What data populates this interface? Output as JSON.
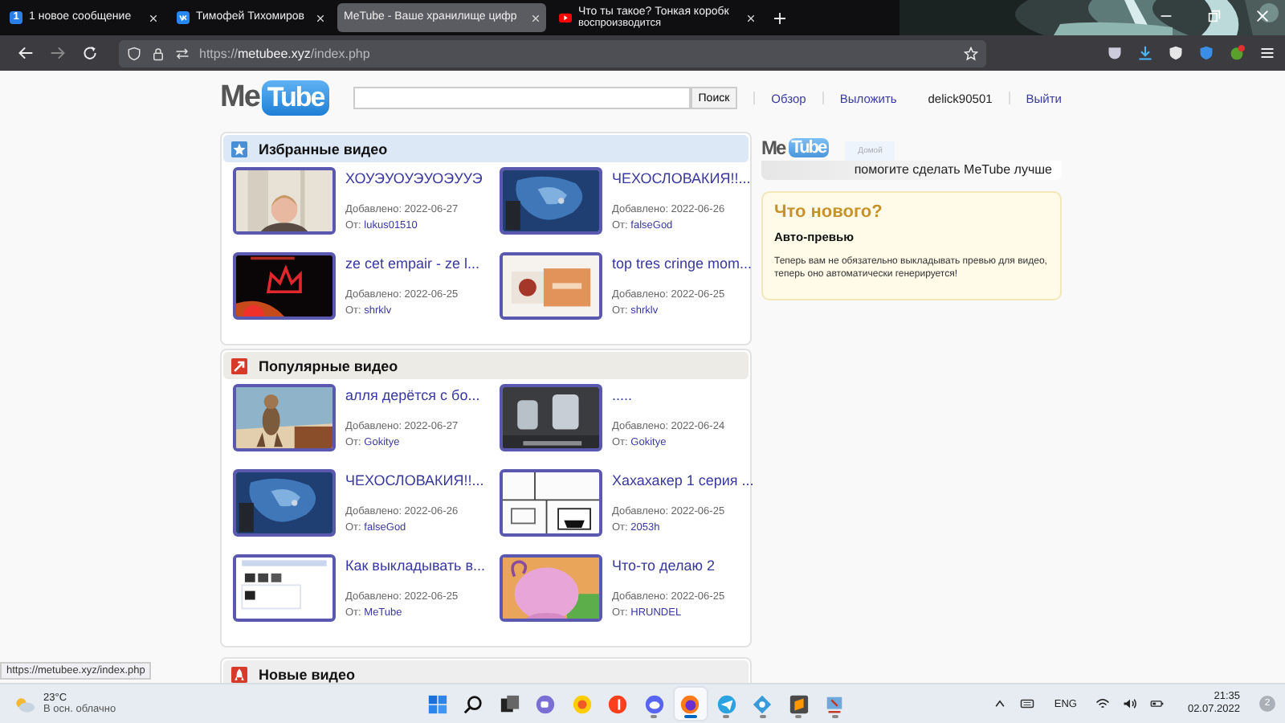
{
  "browser": {
    "tabs": [
      {
        "kind": "mail",
        "icon_text": "1",
        "title": "1 новое сообщение",
        "selected": false
      },
      {
        "kind": "social",
        "title": "Тимофей Тихомиров",
        "selected": false
      },
      {
        "kind": "page",
        "title": "MeTube - Ваше хранилище цифр",
        "selected": true
      },
      {
        "kind": "video",
        "title": "Что ты такое? Тонкая коробк",
        "subtitle": "воспроизводится",
        "selected": false
      }
    ],
    "url": {
      "scheme": "https://",
      "host": "metubee.xyz",
      "path": "/index.php"
    },
    "status_url": "https://metubee.xyz/index.php"
  },
  "site": {
    "logo": {
      "left": "Me",
      "right": "Tube"
    },
    "search_button": "Поиск",
    "nav_links": [
      "Обзор",
      "Выложить"
    ],
    "user": "delick90501",
    "logout": "Выйти",
    "sections": [
      {
        "kind": "favorites",
        "title": "Избранные видео",
        "videos": [
          {
            "title": "ХОУЭУОУЭУОЭУУЭ",
            "added": "Добавлено: 2022-06-27",
            "by": "От:",
            "author": "lukus01510"
          },
          {
            "title": "ЧЕХОСЛОВАКИЯ!!...",
            "added": "Добавлено: 2022-06-26",
            "by": "От:",
            "author": "falseGod"
          },
          {
            "title": "ze cet empair - ze l...",
            "added": "Добавлено: 2022-06-25",
            "by": "От:",
            "author": "shrklv"
          },
          {
            "title": "top tres cringe mom...",
            "added": "Добавлено: 2022-06-25",
            "by": "От:",
            "author": "shrklv"
          }
        ]
      },
      {
        "kind": "popular",
        "title": "Популярные видео",
        "videos": [
          {
            "title": "алля дерётся с бо...",
            "added": "Добавлено: 2022-06-27",
            "by": "От:",
            "author": "Gokitye"
          },
          {
            "title": ".....",
            "added": "Добавлено: 2022-06-24",
            "by": "От:",
            "author": "Gokitye"
          },
          {
            "title": "ЧЕХОСЛОВАКИЯ!!...",
            "added": "Добавлено: 2022-06-26",
            "by": "От:",
            "author": "falseGod"
          },
          {
            "title": "Хахахакер 1 серия ...",
            "added": "Добавлено: 2022-06-25",
            "by": "От:",
            "author": "2053h"
          },
          {
            "title": "Как выкладывать в...",
            "added": "Добавлено: 2022-06-25",
            "by": "От:",
            "author": "MeTube"
          },
          {
            "title": "Что-то делаю 2",
            "added": "Добавлено: 2022-06-25",
            "by": "От:",
            "author": "HRUNDEL"
          }
        ]
      },
      {
        "kind": "new",
        "title": "Новые видео"
      }
    ],
    "banner": {
      "logo": {
        "left": "Me",
        "right": "Tube"
      },
      "tab": "Домой",
      "slogan": "помогите сделать MeTube лучше"
    },
    "news": {
      "heading": "Что нового?",
      "title": "Авто-превью",
      "text": "Теперь вам не обязательно выкладывать превью для видео, теперь оно автоматически генерируется!"
    }
  },
  "taskbar": {
    "weather": {
      "temp": "23°C",
      "desc": "В осн. облачно"
    },
    "apps": [
      {
        "kind": "start",
        "open": false,
        "selected": false
      },
      {
        "kind": "search",
        "open": false,
        "selected": false
      },
      {
        "kind": "taskview",
        "open": false,
        "selected": false
      },
      {
        "kind": "chat",
        "open": false,
        "selected": false
      },
      {
        "kind": "music",
        "open": false,
        "selected": false
      },
      {
        "kind": "redcircle",
        "open": false,
        "selected": false
      },
      {
        "kind": "discord",
        "open": true,
        "selected": false
      },
      {
        "kind": "browser",
        "open": true,
        "selected": true
      },
      {
        "kind": "messenger",
        "open": true,
        "selected": false
      },
      {
        "kind": "network",
        "open": true,
        "selected": false
      },
      {
        "kind": "editor",
        "open": true,
        "selected": false
      },
      {
        "kind": "tool",
        "open": true,
        "selected": false
      }
    ],
    "language": "ENG",
    "time": "21:35",
    "date": "02.07.2022",
    "notifications": "2"
  }
}
